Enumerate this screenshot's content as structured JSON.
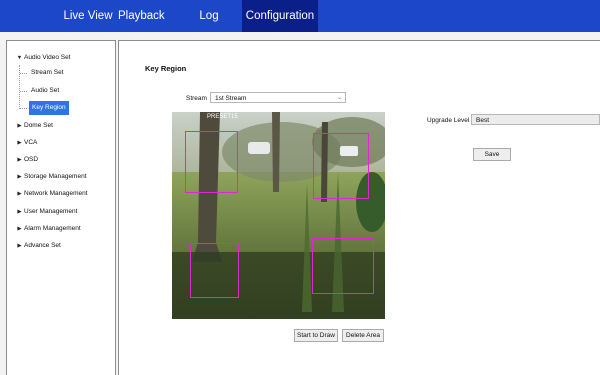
{
  "nav": {
    "tabs": [
      "Live View",
      "Playback",
      "Log",
      "Configuration"
    ],
    "active": "Configuration"
  },
  "sidebar": {
    "audio_video_set": "Audio Video Set",
    "children": [
      "Stream Set",
      "Audio Set",
      "Key Region"
    ],
    "selected_child": "Key Region",
    "items": [
      "Dome Set",
      "VCA",
      "OSD",
      "Storage Management",
      "Network Management",
      "User Management",
      "Alarm Management",
      "Advance Set"
    ]
  },
  "main": {
    "title": "Key Region",
    "stream_label": "Stream",
    "stream_value": "1st Stream",
    "upgrade_label": "Upgrade Level",
    "upgrade_value": "Best",
    "save_label": "Save",
    "start_draw_label": "Start to Draw",
    "delete_area_label": "Delete Area",
    "osd_text": "PRESET15"
  },
  "colors": {
    "nav_bar": "#1d47c9",
    "nav_active": "#0a1f8a",
    "selected_item": "#2f74e6",
    "region_outline": "#e126d8"
  }
}
